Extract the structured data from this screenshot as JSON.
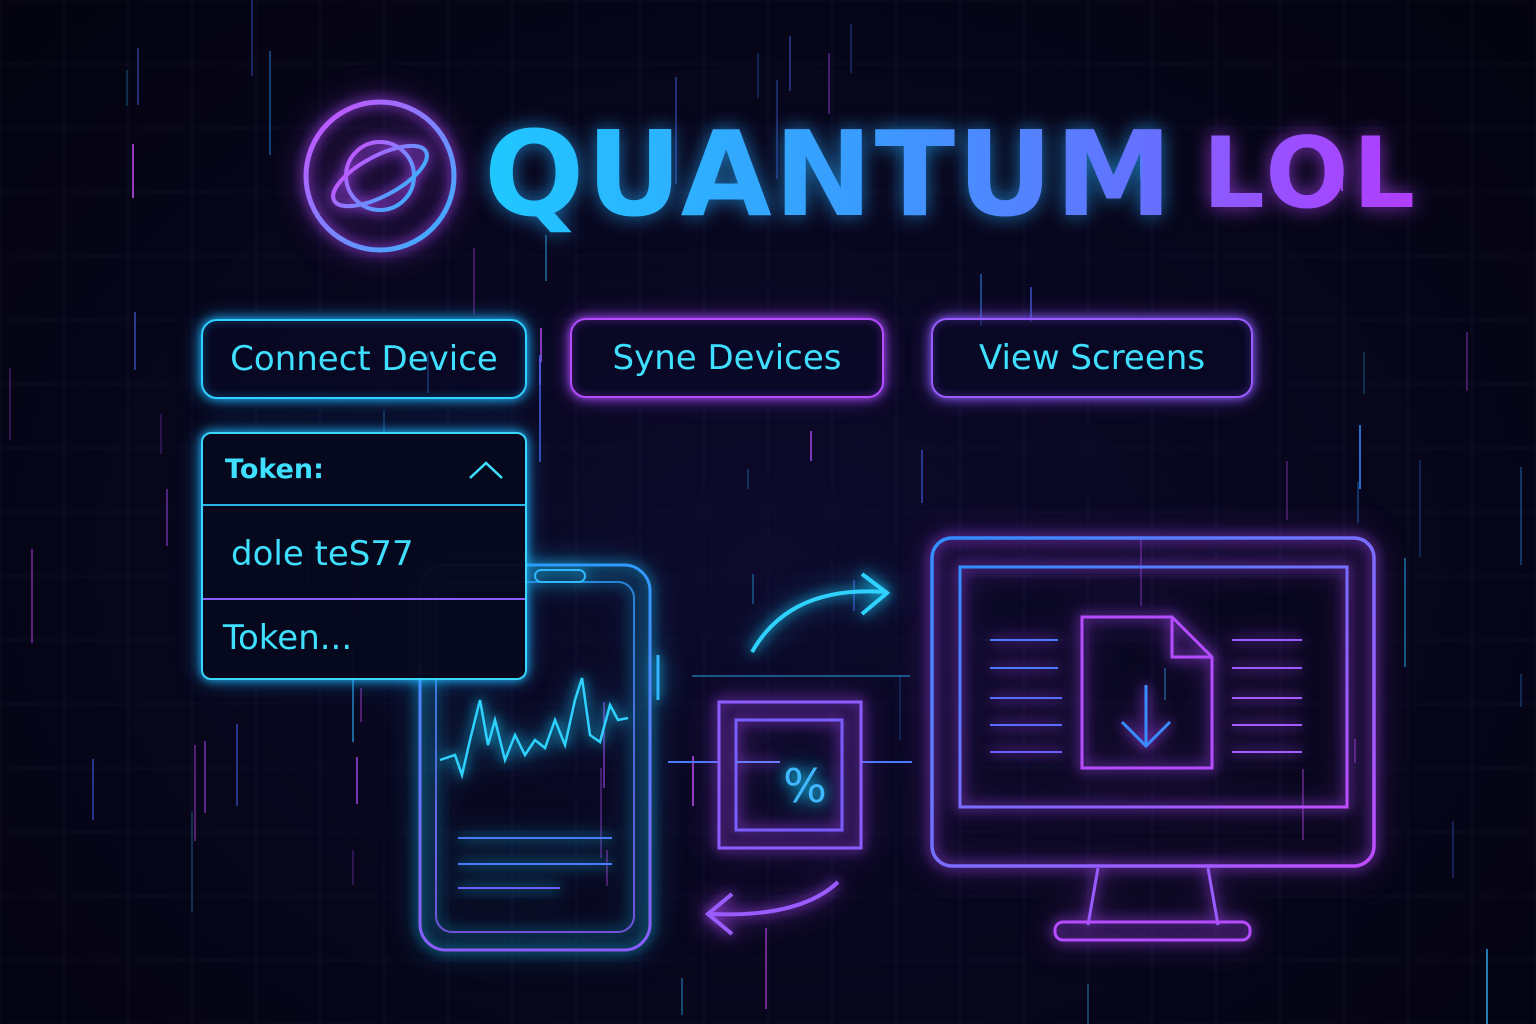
{
  "brand": {
    "name_primary": "QUANTUM",
    "name_secondary": "LOL",
    "logo_icon": "orbit-planet-icon"
  },
  "actions": {
    "connect_label": "Connect Device",
    "sync_label": "Syne Devices",
    "view_label": "View Screens"
  },
  "token_dropdown": {
    "label": "Token:",
    "expanded": true,
    "options": [
      "dole teS77",
      "Token..."
    ]
  },
  "illustration": {
    "center_symbol": "%",
    "icons": [
      "phone-chart-icon",
      "transfer-box-icon",
      "monitor-download-icon",
      "arrow-right-curved-icon",
      "arrow-left-curved-icon"
    ]
  },
  "colors": {
    "background": "#07061a",
    "cyan_accent": "#2fd2ff",
    "violet_accent": "#b64cff",
    "blue_accent": "#3a7bff"
  }
}
